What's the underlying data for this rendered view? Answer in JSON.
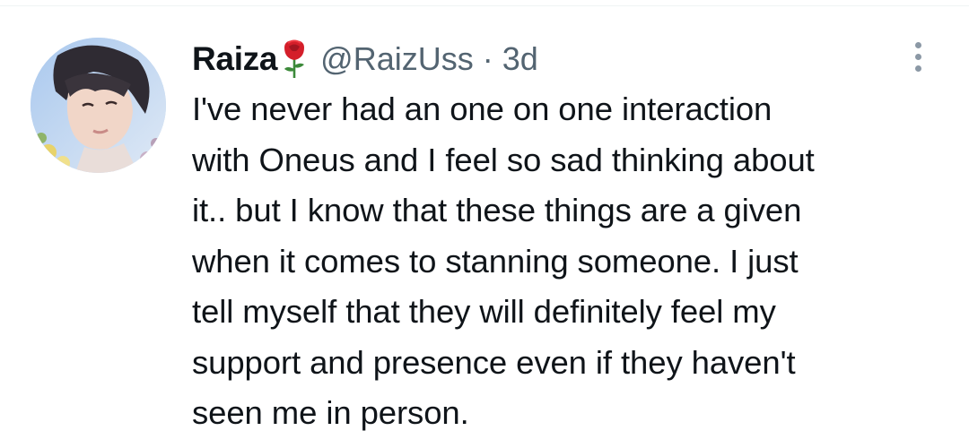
{
  "tweet": {
    "author": {
      "display_name": "Raiza",
      "handle": "@RaizUss",
      "emoji_icon": "rose-icon",
      "avatar": "avatar-photo"
    },
    "separator": "·",
    "timestamp": "3d",
    "more_icon": "more-vertical-icon",
    "text_lines": [
      "I've never had an one on one interaction",
      "with Oneus and I feel so sad thinking about",
      "it.. but I know that these things are a given",
      "when it comes to stanning someone. I just",
      "tell myself that they will definitely feel my",
      "support and presence even if they haven't",
      "seen me in person."
    ]
  },
  "colors": {
    "primary_text": "#0f1419",
    "secondary_text": "#536471",
    "divider": "#eff3f4",
    "icon_gray": "#8b98a5"
  }
}
